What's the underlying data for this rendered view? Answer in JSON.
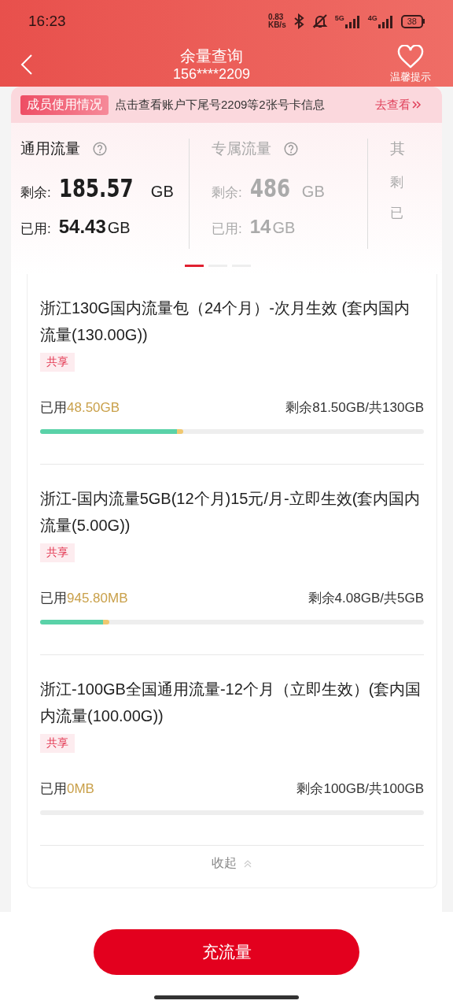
{
  "status_bar": {
    "time": "16:23",
    "speed_value": "0.83",
    "speed_unit": "KB/s",
    "network_1": "5G",
    "network_2": "4G",
    "battery": "38"
  },
  "header": {
    "title": "余量查询",
    "subtitle": "156****2209",
    "tip": "温馨提示"
  },
  "members_banner": {
    "tag": "成员使用情况",
    "text": "点击查看账户下尾号2209等2张号卡信息",
    "link": "去查看"
  },
  "summaries": [
    {
      "title": "通用流量",
      "selected": true,
      "remaining_label": "剩余:",
      "remaining_value": "185.57",
      "remaining_unit": "GB",
      "used_label": "已用:",
      "used_value": "54.43",
      "used_unit": "GB"
    },
    {
      "title": "专属流量",
      "selected": false,
      "remaining_label": "剩余:",
      "remaining_value": "486",
      "remaining_unit": "GB",
      "used_label": "已用:",
      "used_value": "14",
      "used_unit": "GB"
    },
    {
      "title": "其",
      "selected": false,
      "remaining_label": "剩",
      "used_label": "已"
    }
  ],
  "page_dots": [
    {
      "selected": true
    },
    {
      "selected": false
    },
    {
      "selected": false
    }
  ],
  "plans": [
    {
      "name": "浙江130G国内流量包（24个月）-次月生效 (套内国内流量(130.00G))",
      "tag": "共享",
      "used_label": "已用",
      "used": "48.50GB",
      "remaining": "剩余81.50GB/共130GB",
      "level": 0.373
    },
    {
      "name": "浙江-国内流量5GB(12个月)15元/月-立即生效(套内国内流量(5.00G))",
      "tag": "共享",
      "used_label": "已用",
      "used": "945.80MB",
      "remaining": "剩余4.08GB/共5GB",
      "level": 0.18
    },
    {
      "name": "浙江-100GB全国通用流量-12个月（立即生效）(套内国内流量(100.00G))",
      "tag": "共享",
      "used_label": "已用",
      "used": "0MB",
      "remaining": "剩余100GB/共100GB"
    }
  ],
  "collapse": "收起",
  "recharge_button": "充流量"
}
